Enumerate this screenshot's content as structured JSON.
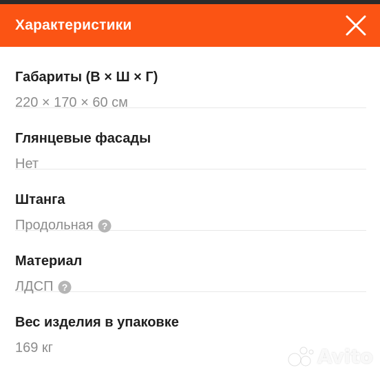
{
  "colors": {
    "header_bg": "#fb5414",
    "top_strip": "#2b2b2b",
    "label_text": "#1f1f1f",
    "value_text": "#8c8c8c",
    "divider": "#e8e8e8"
  },
  "header": {
    "title": "Характеристики",
    "close_icon": "close-icon"
  },
  "specs": [
    {
      "label": "Габариты (В × Ш × Г)",
      "value": "220 × 170 × 60 см",
      "help": false
    },
    {
      "label": "Глянцевые фасады",
      "value": "Нет",
      "help": false
    },
    {
      "label": "Штанга",
      "value": "Продольная",
      "help": true
    },
    {
      "label": "Материал",
      "value": "ЛДСП",
      "help": true
    },
    {
      "label": "Вес изделия в упаковке",
      "value": "169 кг",
      "help": false
    }
  ],
  "watermark": {
    "text": "Avito",
    "icon": "avito-logo-icon"
  }
}
